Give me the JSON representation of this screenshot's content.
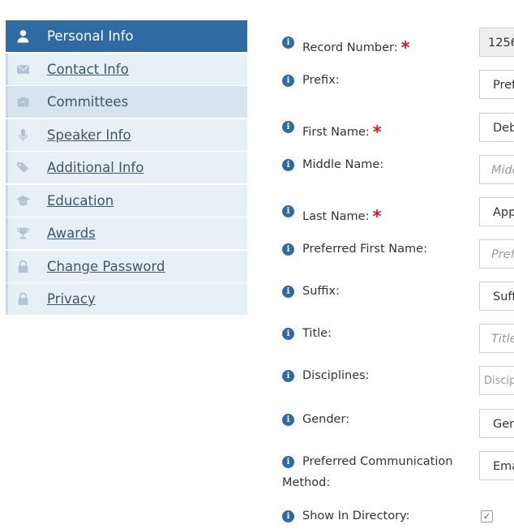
{
  "sidebar": {
    "items": [
      {
        "label": "Personal Info",
        "icon": "user-icon"
      },
      {
        "label": "Contact Info",
        "icon": "envelope-icon"
      },
      {
        "label": "Committees",
        "icon": "briefcase-icon"
      },
      {
        "label": "Speaker Info",
        "icon": "microphone-icon"
      },
      {
        "label": "Additional Info",
        "icon": "tags-icon"
      },
      {
        "label": "Education",
        "icon": "graduation-cap-icon"
      },
      {
        "label": "Awards",
        "icon": "trophy-icon"
      },
      {
        "label": "Change Password",
        "icon": "lock-icon"
      },
      {
        "label": "Privacy",
        "icon": "lock-icon"
      }
    ],
    "active_index": 0
  },
  "form": {
    "fields": [
      {
        "label": "Record Number:",
        "required": true,
        "value": "1256"
      },
      {
        "label": "Prefix:",
        "required": false,
        "value": "Pref"
      },
      {
        "label": "First Name:",
        "required": true,
        "value": "Deb"
      },
      {
        "label": "Middle Name:",
        "required": false,
        "placeholder": "Midd"
      },
      {
        "label": "Last Name:",
        "required": true,
        "value": "App"
      },
      {
        "label": "Preferred First Name:",
        "required": false,
        "placeholder": "Pref"
      },
      {
        "label": "Suffix:",
        "required": false,
        "value": "Suff"
      },
      {
        "label": "Title:",
        "required": false,
        "placeholder": "Title"
      },
      {
        "label": "Disciplines:",
        "required": false,
        "placeholder": "Discip"
      },
      {
        "label": "Gender:",
        "required": false,
        "value": "Gen"
      },
      {
        "label_line1": "Preferred Communication",
        "label_line2": "Method:",
        "required": false,
        "value": "Ema"
      },
      {
        "label": "Show In Directory:",
        "required": false,
        "checked": true
      }
    ],
    "required_mark": "*",
    "info_glyph": "i",
    "check_glyph": "✓"
  },
  "colors": {
    "accent": "#2f6aa3",
    "required": "#d01c2a",
    "nav_bg": "#e8f0f7"
  }
}
